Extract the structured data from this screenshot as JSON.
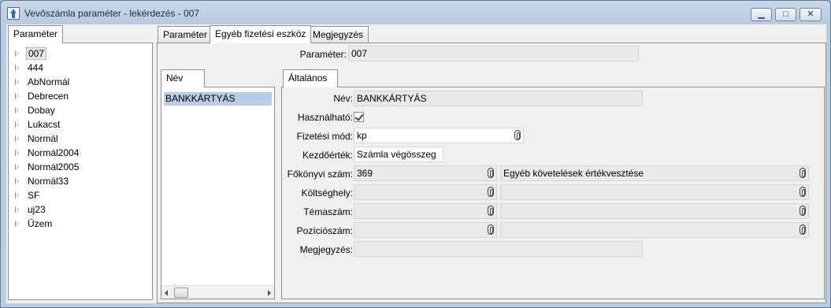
{
  "window": {
    "title": "Vevőszámla paraméter - lekérdezés - 007",
    "min_icon": "minimize-icon",
    "max_icon": "maximize-icon",
    "close_icon": "close-icon"
  },
  "left": {
    "tab_label": "Paraméter",
    "tree_items": [
      "007",
      "444",
      "AbNormál",
      "Debrecen",
      "Dobay",
      "Lukacst",
      "Normál",
      "Normál2004",
      "Normál2005",
      "Normál33",
      "SF",
      "uj23",
      "Üzem"
    ],
    "selected_index": 0
  },
  "right": {
    "tabs": [
      "Paraméter",
      "Egyéb fizetési eszköz",
      "Megjegyzés"
    ],
    "active_tab_index": 1,
    "parameter_label": "Paraméter:",
    "parameter_value": "007",
    "nev_tab_label": "Név",
    "nev_list": [
      "BANKKÁRTYÁS"
    ],
    "altalanos_tab_label": "Általános",
    "fields": {
      "nev_label": "Név:",
      "nev_value": "BANKKÁRTYÁS",
      "hasznalhato_label": "Használható:",
      "hasznalhato_checked": true,
      "fizetesi_mod_label": "Fizetési mód:",
      "fizetesi_mod_value": "kp",
      "kezdoertek_label": "Kezdőérték:",
      "kezdoertek_value": "Számla végösszeg",
      "fokonyvi_szam_label": "Főkönyvi szám:",
      "fokonyvi_szam_value": "369",
      "fokonyvi_szam_desc": "Egyéb követelések értékvesztése",
      "koltseghely_label": "Költséghely:",
      "koltseghely_value": "",
      "koltseghely_desc": "",
      "temaszam_label": "Témaszám:",
      "temaszam_value": "",
      "temaszam_desc": "",
      "pozicioszam_label": "Pozíciószám:",
      "pozicioszam_value": "",
      "pozicioszam_desc": "",
      "megjegyzes_label": "Megjegyzés:",
      "megjegyzes_value": ""
    }
  },
  "colors": {
    "titlebar": "#c9d8ea",
    "selection": "#b8cde6",
    "panel": "#f0f0f0",
    "readonly_field": "#e9e9e9"
  }
}
